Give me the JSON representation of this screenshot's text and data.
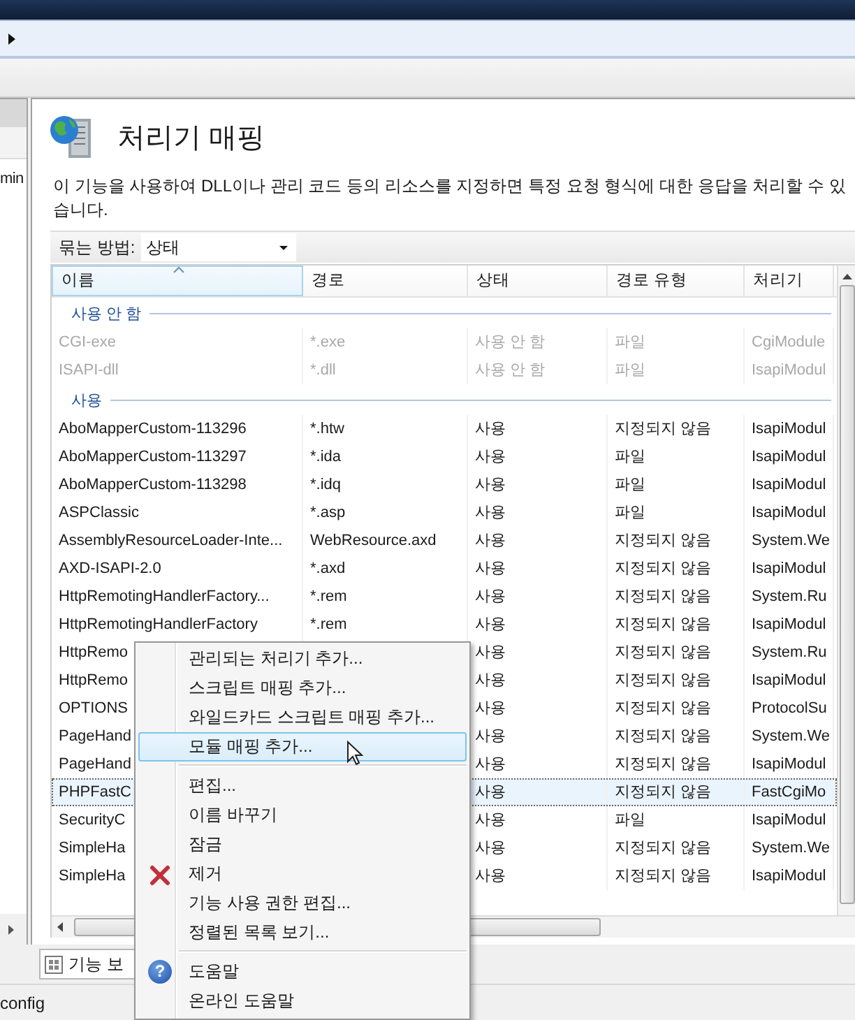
{
  "sidebar": {
    "text": "min"
  },
  "feature": {
    "title": "처리기 매핑",
    "description": "이 기능을 사용하여 DLL이나 관리 코드 등의 리소스를 지정하면 특정 요청 형식에 대한 응답을 처리할 수 있습니다.",
    "group_by": {
      "label": "묶는 방법:",
      "value": "상태"
    }
  },
  "table": {
    "columns": [
      "이름",
      "경로",
      "상태",
      "경로 유형",
      "처리기"
    ],
    "groups": [
      {
        "label": "사용 안 함",
        "rows": [
          {
            "name": "CGI-exe",
            "path": "*.exe",
            "status": "사용 안 함",
            "path_type": "파일",
            "handler": "CgiModule",
            "disabled": true,
            "selected": false
          },
          {
            "name": "ISAPI-dll",
            "path": "*.dll",
            "status": "사용 안 함",
            "path_type": "파일",
            "handler": "IsapiModul",
            "disabled": true,
            "selected": false
          }
        ]
      },
      {
        "label": "사용",
        "rows": [
          {
            "name": "AboMapperCustom-113296",
            "path": "*.htw",
            "status": "사용",
            "path_type": "지정되지 않음",
            "handler": "IsapiModul",
            "disabled": false,
            "selected": false
          },
          {
            "name": "AboMapperCustom-113297",
            "path": "*.ida",
            "status": "사용",
            "path_type": "파일",
            "handler": "IsapiModul",
            "disabled": false,
            "selected": false
          },
          {
            "name": "AboMapperCustom-113298",
            "path": "*.idq",
            "status": "사용",
            "path_type": "파일",
            "handler": "IsapiModul",
            "disabled": false,
            "selected": false
          },
          {
            "name": "ASPClassic",
            "path": "*.asp",
            "status": "사용",
            "path_type": "파일",
            "handler": "IsapiModul",
            "disabled": false,
            "selected": false
          },
          {
            "name": "AssemblyResourceLoader-Inte...",
            "path": "WebResource.axd",
            "status": "사용",
            "path_type": "지정되지 않음",
            "handler": "System.We",
            "disabled": false,
            "selected": false
          },
          {
            "name": "AXD-ISAPI-2.0",
            "path": "*.axd",
            "status": "사용",
            "path_type": "지정되지 않음",
            "handler": "IsapiModul",
            "disabled": false,
            "selected": false
          },
          {
            "name": "HttpRemotingHandlerFactory...",
            "path": "*.rem",
            "status": "사용",
            "path_type": "지정되지 않음",
            "handler": "System.Ru",
            "disabled": false,
            "selected": false
          },
          {
            "name": "HttpRemotingHandlerFactory",
            "path": "*.rem",
            "status": "사용",
            "path_type": "지정되지 않음",
            "handler": "IsapiModul",
            "disabled": false,
            "selected": false
          },
          {
            "name": "HttpRemo",
            "status": "사용",
            "path_type": "지정되지 않음",
            "handler": "System.Ru",
            "disabled": false,
            "selected": false
          },
          {
            "name": "HttpRemo",
            "status": "사용",
            "path_type": "지정되지 않음",
            "handler": "IsapiModul",
            "disabled": false,
            "selected": false
          },
          {
            "name": "OPTIONS",
            "status": "사용",
            "path_type": "지정되지 않음",
            "handler": "ProtocolSu",
            "disabled": false,
            "selected": false
          },
          {
            "name": "PageHand",
            "status": "사용",
            "path_type": "지정되지 않음",
            "handler": "System.We",
            "disabled": false,
            "selected": false
          },
          {
            "name": "PageHand",
            "status": "사용",
            "path_type": "지정되지 않음",
            "handler": "IsapiModul",
            "disabled": false,
            "selected": false
          },
          {
            "name": "PHPFastC",
            "status": "사용",
            "path_type": "지정되지 않음",
            "handler": "FastCgiMo",
            "disabled": false,
            "selected": true
          },
          {
            "name": "SecurityC",
            "status": "사용",
            "path_type": "파일",
            "handler": "IsapiModul",
            "disabled": false,
            "selected": false
          },
          {
            "name": "SimpleHa",
            "status": "사용",
            "path_type": "지정되지 않음",
            "handler": "System.We",
            "disabled": false,
            "selected": false
          },
          {
            "name": "SimpleHa",
            "status": "사용",
            "path_type": "지정되지 않음",
            "handler": "IsapiModul",
            "disabled": false,
            "selected": false
          }
        ]
      }
    ]
  },
  "context_menu": {
    "sections": [
      [
        {
          "label": "관리되는 처리기 추가...",
          "kind": "plain",
          "selected": false
        },
        {
          "label": "스크립트 매핑 추가...",
          "kind": "plain",
          "selected": false
        },
        {
          "label": "와일드카드 스크립트 매핑 추가...",
          "kind": "plain",
          "selected": false
        },
        {
          "label": "모듈 매핑 추가...",
          "kind": "plain",
          "selected": true
        }
      ],
      [
        {
          "label": "편집...",
          "kind": "plain",
          "selected": false
        },
        {
          "label": "이름 바꾸기",
          "kind": "plain",
          "selected": false
        },
        {
          "label": "잠금",
          "kind": "plain",
          "selected": false
        },
        {
          "label": "제거",
          "kind": "remove",
          "selected": false
        },
        {
          "label": "기능 사용 권한 편집...",
          "kind": "plain",
          "selected": false
        },
        {
          "label": "정렬된 목록 보기...",
          "kind": "plain",
          "selected": false
        }
      ],
      [
        {
          "label": "도움말",
          "kind": "help",
          "icon_glyph": "?",
          "selected": false
        },
        {
          "label": "온라인 도움말",
          "kind": "plain",
          "selected": false
        }
      ]
    ]
  },
  "bottom_tab": {
    "label": "기능 보"
  },
  "status_bar": {
    "text": "config"
  }
}
